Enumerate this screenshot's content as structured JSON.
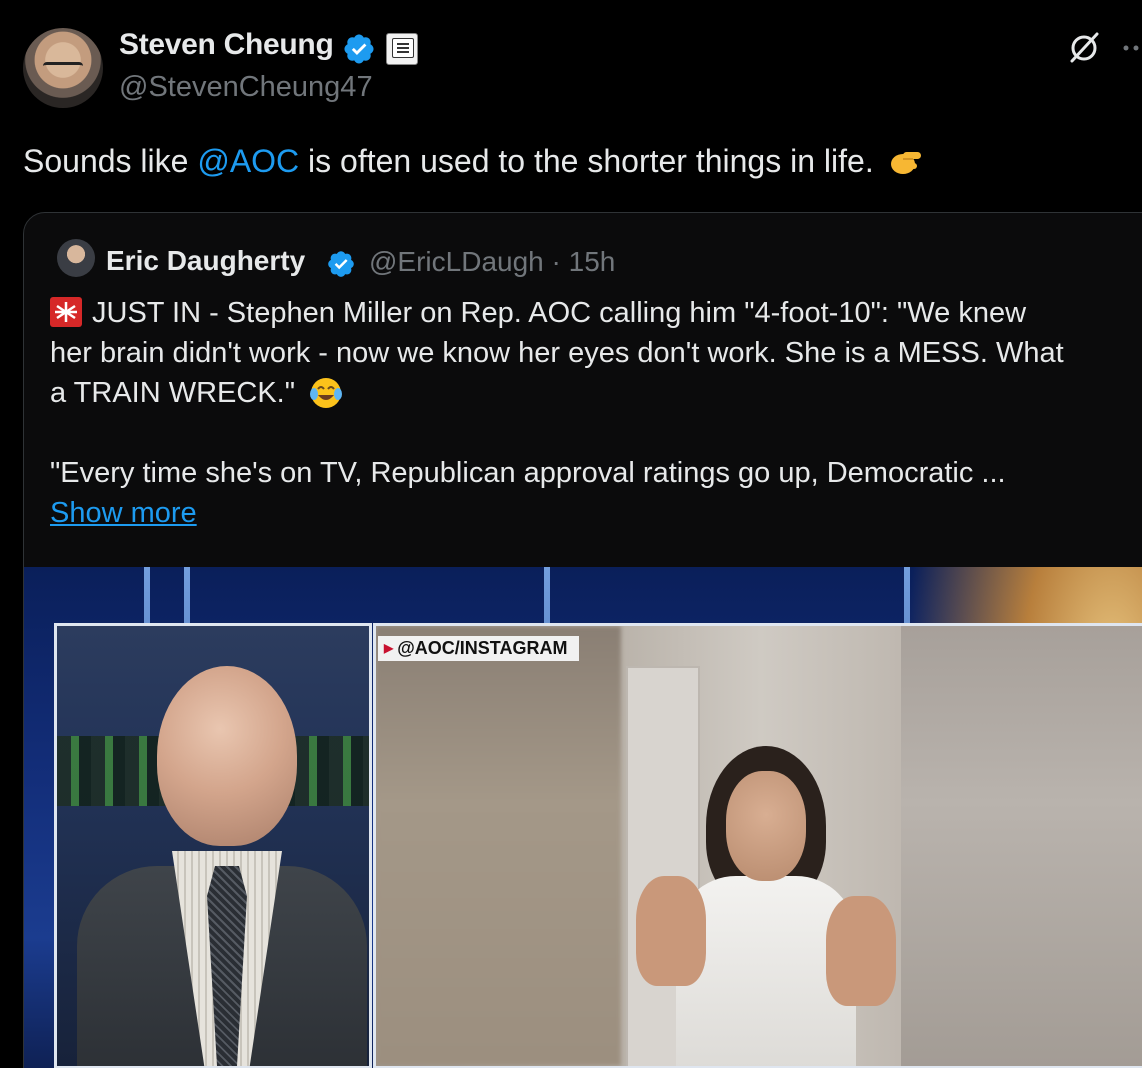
{
  "tweet": {
    "author_name": "Steven Cheung",
    "author_handle": "@StevenCheung47",
    "text_before": "Sounds like ",
    "mention": "@AOC",
    "text_after": " is often used to the shorter things in life.",
    "emoji": "pinching-hand",
    "verified_color": "#1d9bf0",
    "affiliate_badge": "white-house-icon"
  },
  "quote": {
    "author_name": "Eric Daugherty",
    "author_handle": "@EricLDaugh",
    "separator": "·",
    "time": "15h",
    "line1": "JUST IN - Stephen Miller on Rep. AOC calling him \"4-foot-10\": \"We knew",
    "line2": "her brain didn't work - now we know her eyes don't work. She is a MESS. What",
    "line3": "a TRAIN WRECK.\"",
    "line4": "\"Every time she's on TV, Republican approval ratings go up, Democratic ...",
    "show_more": "Show more",
    "media": {
      "chyron": "@AOC/INSTAGRAM"
    }
  },
  "colors": {
    "background": "#000000",
    "text": "#e7e9ea",
    "secondary_text": "#71767b",
    "link": "#1d9bf0",
    "border": "#2f3336"
  }
}
